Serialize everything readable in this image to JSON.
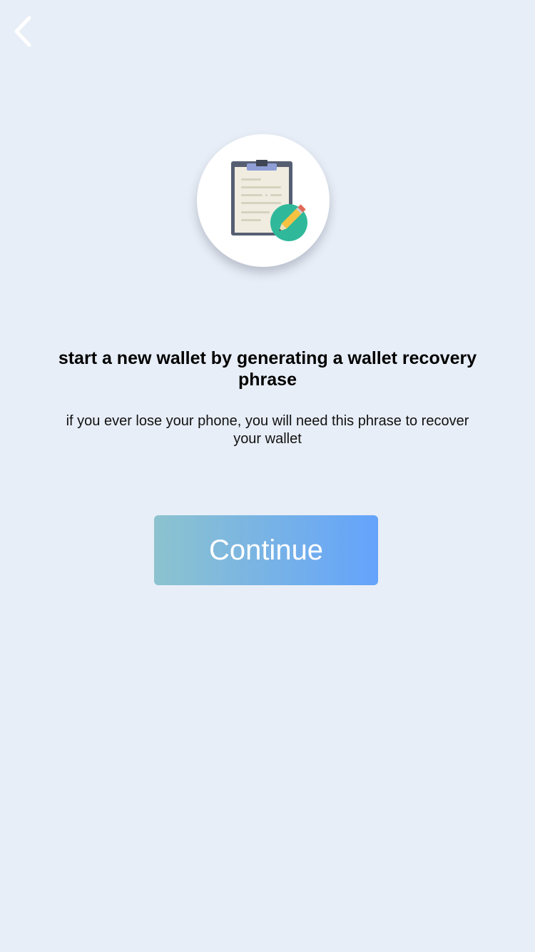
{
  "nav": {
    "back_icon": "chevron-left-icon"
  },
  "illustration": {
    "icon": "clipboard-pencil-icon",
    "colors": {
      "clip": "#8f9ed6",
      "board": "#565f72",
      "paper": "#f0ece0",
      "lines": "#d6d2bf",
      "badge": "#2fb99a",
      "pencil": "#f5c242"
    }
  },
  "content": {
    "headline": "start a new wallet by generating a wallet recovery phrase",
    "description": "if you ever lose your phone, you will need this phrase to recover your wallet"
  },
  "actions": {
    "continue_label": "Continue"
  },
  "colors": {
    "background": "#e8eef7",
    "button_gradient_start": "#8cc3cf",
    "button_gradient_end": "#64a3fb",
    "button_text": "#ffffff"
  }
}
